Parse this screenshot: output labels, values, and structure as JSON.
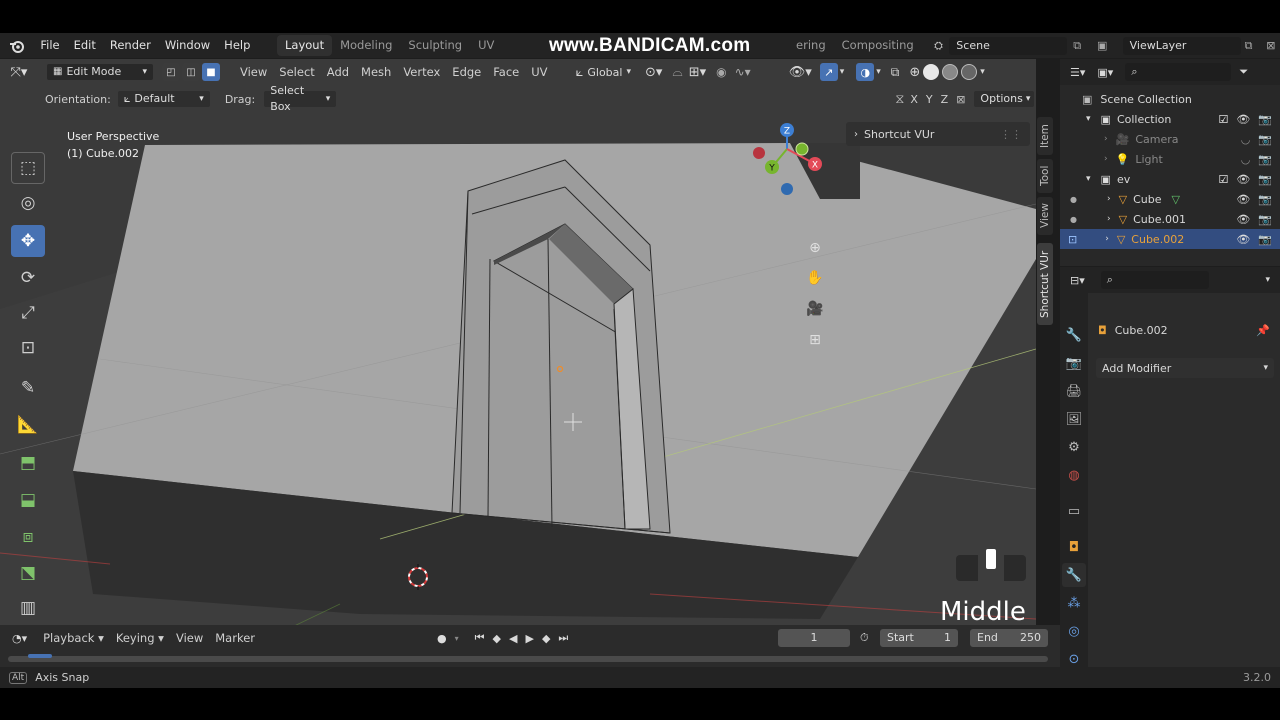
{
  "topbar": {
    "menus": [
      "File",
      "Edit",
      "Render",
      "Window",
      "Help"
    ],
    "workspaces": [
      "Layout",
      "Modeling",
      "Sculpting",
      "UV Editing"
    ],
    "workspaces_right": [
      "ering",
      "Compositing"
    ],
    "watermark": "www.BANDICAM.com",
    "scene": "Scene",
    "view_layer": "ViewLayer"
  },
  "viewport_header": {
    "mode": "Edit Mode",
    "menus": [
      "View",
      "Select",
      "Add",
      "Mesh",
      "Vertex",
      "Edge",
      "Face",
      "UV"
    ],
    "transform_orientation": "Global"
  },
  "tool_settings": {
    "orientation_label": "Orientation:",
    "orientation_value": "Default",
    "drag_label": "Drag:",
    "drag_value": "Select Box",
    "axes": [
      "X",
      "Y",
      "Z"
    ],
    "options_label": "Options"
  },
  "viewport": {
    "perspective": "User Perspective",
    "object": "(1) Cube.002",
    "panel_title": "Shortcut VUr",
    "side_tabs": [
      "Item",
      "Tool",
      "View",
      "Shortcut VUr"
    ],
    "gizmo_axes": [
      "Z",
      "Y",
      "X"
    ],
    "overlay_key": "Middle"
  },
  "outliner": {
    "root": "Scene Collection",
    "rows": [
      {
        "label": "Collection",
        "type": "collection"
      },
      {
        "label": "Camera",
        "type": "camera",
        "dim": true
      },
      {
        "label": "Light",
        "type": "light",
        "dim": true
      },
      {
        "label": "ev",
        "type": "collection"
      },
      {
        "label": "Cube",
        "type": "mesh"
      },
      {
        "label": "Cube.001",
        "type": "mesh"
      },
      {
        "label": "Cube.002",
        "type": "mesh",
        "selected": true
      }
    ]
  },
  "properties": {
    "object_name": "Cube.002",
    "add_modifier": "Add Modifier"
  },
  "timeline": {
    "menus": [
      "Playback",
      "Keying",
      "View",
      "Marker"
    ],
    "current_frame": "1",
    "start_label": "Start",
    "start": "1",
    "end_label": "End",
    "end": "250"
  },
  "statusbar": {
    "key": "Alt",
    "hint": "Axis Snap",
    "version": "3.2.0"
  },
  "colors": {
    "accent": "#4772b3",
    "selected_row": "#334d80",
    "axis_x": "#e34a58",
    "axis_y": "#77b52e",
    "axis_z": "#3d7fd4",
    "mesh_icon": "#e8a13a"
  }
}
